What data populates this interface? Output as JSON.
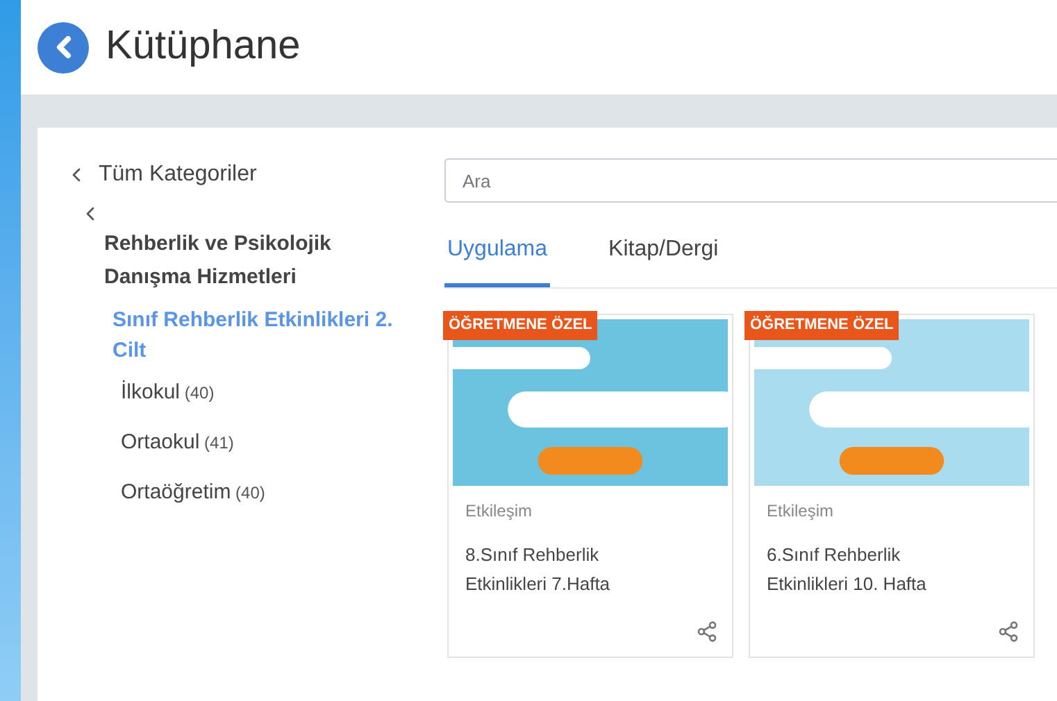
{
  "header": {
    "title": "Kütüphane"
  },
  "sidebar": {
    "root": "Tüm Kategoriler",
    "parent": "Rehberlik ve Psikolojik Danışma Hizmetleri",
    "items": [
      {
        "label": "Sınıf Rehberlik Etkinlikleri 2. Cilt",
        "selected": true
      },
      {
        "label": "İlkokul",
        "count": "(40)",
        "selected": false
      },
      {
        "label": "Ortaokul",
        "count": "(41)",
        "selected": false
      },
      {
        "label": "Ortaöğretim",
        "count": "(40)",
        "selected": false
      }
    ]
  },
  "search": {
    "placeholder": "Ara"
  },
  "tabs": [
    {
      "label": "Uygulama",
      "selected": true
    },
    {
      "label": "Kitap/Dergi",
      "selected": false
    }
  ],
  "cards": [
    {
      "badge": "ÖĞRETMENE ÖZEL",
      "type": "Etkileşim",
      "title": "8.Sınıf Rehberlik Etkinlikleri 7.Hafta",
      "color": "#6cc3df"
    },
    {
      "badge": "ÖĞRETMENE ÖZEL",
      "type": "Etkileşim",
      "title": "6.Sınıf Rehberlik Etkinlikleri 10. Hafta",
      "color": "#a9dcee"
    }
  ]
}
